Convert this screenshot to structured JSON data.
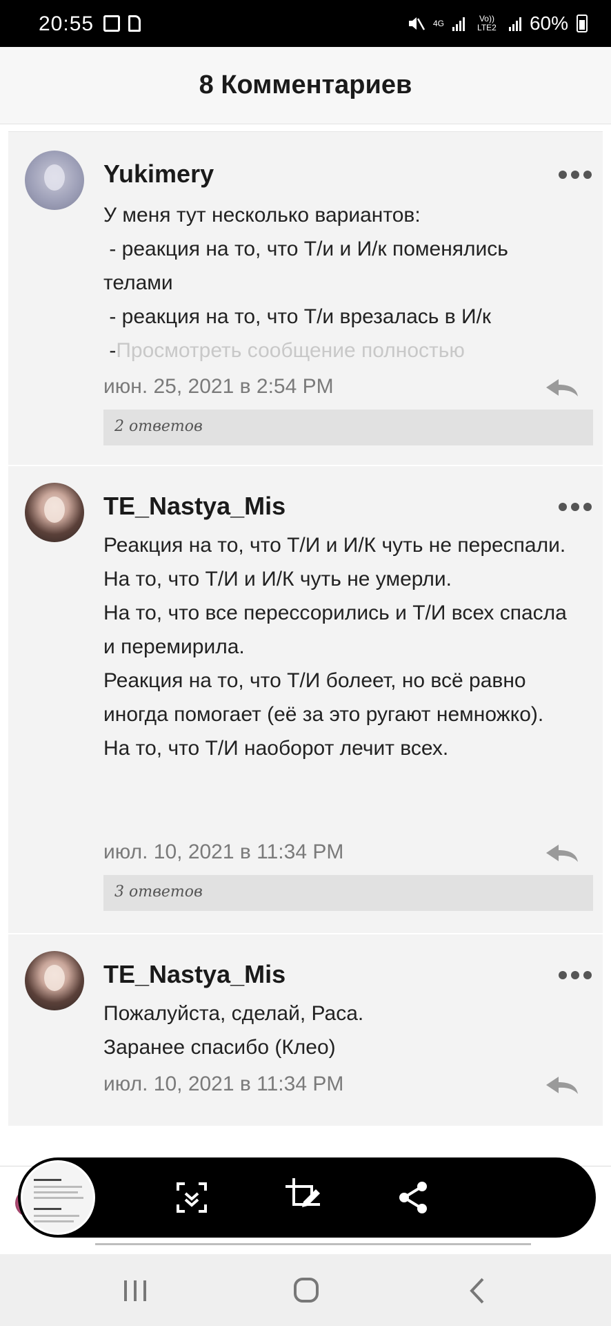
{
  "status_bar": {
    "time": "20:55",
    "network_4g": "4G",
    "network_lte": "Vo)) LTE2",
    "battery": "60%"
  },
  "header": {
    "title": "8 Комментариев"
  },
  "comments": [
    {
      "username": "Yukimery",
      "text": "У меня тут несколько вариантов:\n - реакция на то, что Т/и и И/к поменялись телами\n - реакция на то, что Т/и врезалась в И/к\n -",
      "view_full": "Просмотреть сообщение полностью",
      "date": "июн. 25, 2021 в 2:54 PM",
      "replies": "2 ответов"
    },
    {
      "username": "TE_Nastya_Mis",
      "text": "Реакция на то, что Т/И и И/К чуть не переспали.\nНа то, что Т/И и И/К чуть не умерли.\nНа то, что все перессорились и Т/И всех спасла и перемирила.\nРеакция на то, что Т/И болеет, но всё равно иногда помогает (её за это ругают немножко).\nНа то, что Т/И наоборот лечит всех.",
      "date": "июл. 10, 2021 в 11:34 PM",
      "replies": "3 ответов"
    },
    {
      "username": "TE_Nastya_Mis",
      "text": "Пожалуйста, сделай, Раса.\nЗаранее спасибо (Клео)",
      "date": "июл. 10, 2021 в 11:34 PM"
    }
  ],
  "toolbar": {
    "icons": [
      "scroll-capture-icon",
      "edit-crop-icon",
      "share-icon"
    ]
  },
  "navigation": {
    "icons": [
      "recent-apps-icon",
      "home-icon",
      "back-icon"
    ]
  }
}
